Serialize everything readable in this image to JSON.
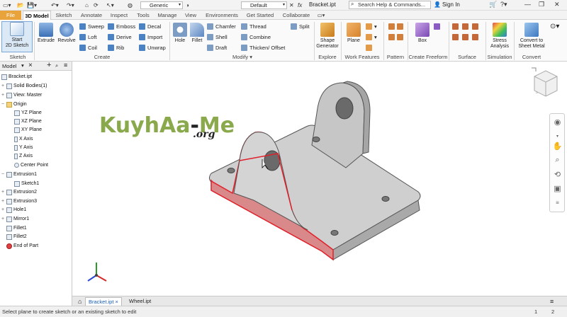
{
  "titlebar": {
    "material": "Generic",
    "appearance": "Default",
    "document_title": "Bracket.ipt",
    "search_placeholder": "Search Help & Commands...",
    "sign_in": "Sign In"
  },
  "tabs": [
    {
      "label": "File"
    },
    {
      "label": "3D Model"
    },
    {
      "label": "Sketch"
    },
    {
      "label": "Annotate"
    },
    {
      "label": "Inspect"
    },
    {
      "label": "Tools"
    },
    {
      "label": "Manage"
    },
    {
      "label": "View"
    },
    {
      "label": "Environments"
    },
    {
      "label": "Get Started"
    },
    {
      "label": "Collaborate"
    }
  ],
  "ribbon": {
    "start_sketch": "Start 2D Sketch",
    "start_sketch_l1": "Start",
    "start_sketch_l2": "2D Sketch",
    "extrude": "Extrude",
    "revolve": "Revolve",
    "sweep": "Sweep",
    "loft": "Loft",
    "coil": "Coil",
    "emboss": "Emboss",
    "derive": "Derive",
    "rib": "Rib",
    "decal": "Decal",
    "import": "Import",
    "unwrap": "Unwrap",
    "hole": "Hole",
    "fillet": "Fillet",
    "chamfer": "Chamfer",
    "shell": "Shell",
    "draft": "Draft",
    "thread": "Thread",
    "combine": "Combine",
    "thicken": "Thicken/ Offset",
    "split": "Split",
    "shape_gen_l1": "Shape",
    "shape_gen_l2": "Generator",
    "plane": "Plane",
    "box": "Box",
    "stress_l1": "Stress",
    "stress_l2": "Analysis",
    "convert_l1": "Convert to",
    "convert_l2": "Sheet Metal",
    "groups": {
      "sketch": "Sketch",
      "create": "Create",
      "modify": "Modify ▾",
      "explore": "Explore",
      "work_features": "Work Features",
      "pattern": "Pattern",
      "create_freeform": "Create Freeform",
      "surface": "Surface",
      "simulation": "Simulation",
      "convert": "Convert"
    }
  },
  "browser": {
    "tab": "Model",
    "nodes": [
      {
        "label": "Bracket.ipt"
      },
      {
        "label": "Solid Bodies(1)"
      },
      {
        "label": "View: Master"
      },
      {
        "label": "Origin"
      },
      {
        "label": "YZ Plane"
      },
      {
        "label": "XZ Plane"
      },
      {
        "label": "XY Plane"
      },
      {
        "label": "X Axis"
      },
      {
        "label": "Y Axis"
      },
      {
        "label": "Z Axis"
      },
      {
        "label": "Center Point"
      },
      {
        "label": "Extrusion1"
      },
      {
        "label": "Sketch1"
      },
      {
        "label": "Extrusion2"
      },
      {
        "label": "Extrusion3"
      },
      {
        "label": "Hole1"
      },
      {
        "label": "Mirror1"
      },
      {
        "label": "Fillet1"
      },
      {
        "label": "Fillet2"
      },
      {
        "label": "End of Part"
      }
    ]
  },
  "watermark": {
    "main": "KuyhAa",
    "dash": "-",
    "tail": "Me",
    "org": ".org"
  },
  "doc_tabs": [
    {
      "label": "Bracket.ipt"
    },
    {
      "label": "Wheel.ipt"
    }
  ],
  "status": {
    "message": "Select plane to create sketch or an existing sketch to edit",
    "count1": "1",
    "count2": "2"
  },
  "colors": {
    "file_tab": "#e8a33a",
    "highlight_face": "#d9898a",
    "edge_highlight": "#e0202a",
    "part": "#c9c9c9"
  }
}
